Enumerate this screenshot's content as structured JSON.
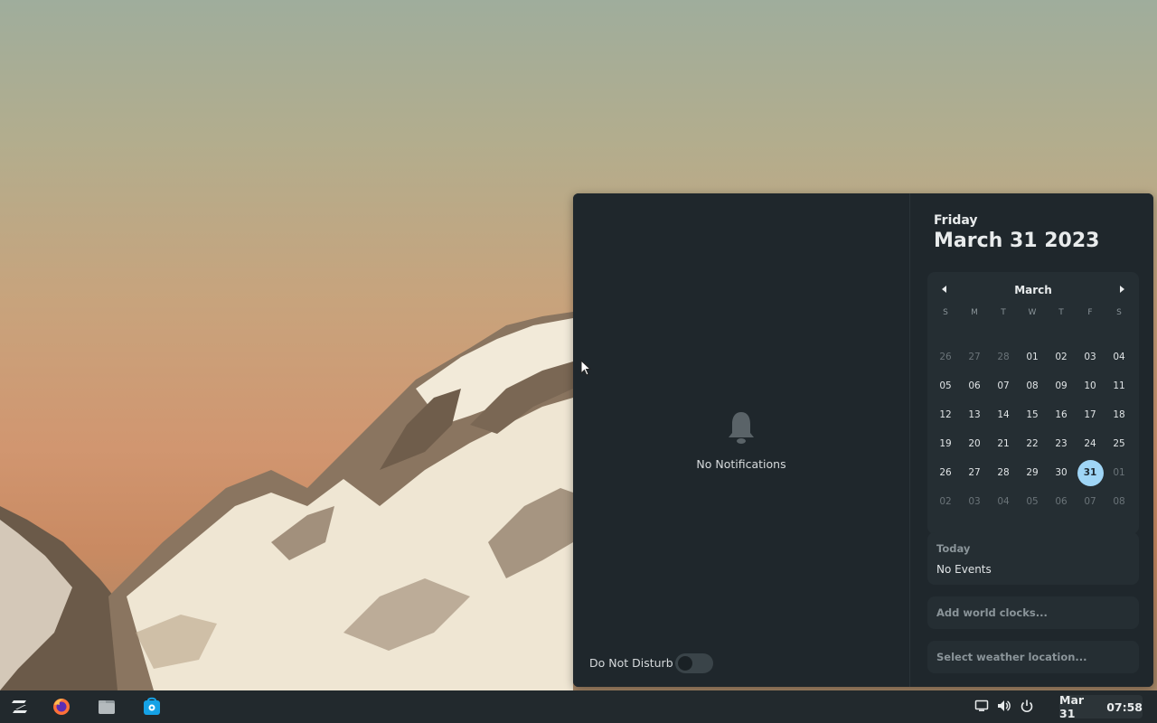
{
  "notifications": {
    "empty_label": "No Notifications",
    "dnd_label": "Do Not Disturb",
    "dnd_enabled": false
  },
  "date_header": {
    "day": "Friday",
    "date": "March 31 2023"
  },
  "calendar": {
    "month": "March",
    "weekdays": [
      "S",
      "M",
      "T",
      "W",
      "T",
      "F",
      "S"
    ],
    "weeks": [
      [
        "26",
        "27",
        "28",
        "01",
        "02",
        "03",
        "04"
      ],
      [
        "05",
        "06",
        "07",
        "08",
        "09",
        "10",
        "11"
      ],
      [
        "12",
        "13",
        "14",
        "15",
        "16",
        "17",
        "18"
      ],
      [
        "19",
        "20",
        "21",
        "22",
        "23",
        "24",
        "25"
      ],
      [
        "26",
        "27",
        "28",
        "29",
        "30",
        "31",
        "01"
      ],
      [
        "02",
        "03",
        "04",
        "05",
        "06",
        "07",
        "08"
      ]
    ],
    "selected_day": "31",
    "accent_color": "#9fd5f6"
  },
  "events": {
    "heading": "Today",
    "status": "No Events"
  },
  "world_clocks": {
    "placeholder": "Add world clocks..."
  },
  "weather": {
    "placeholder": "Select weather location..."
  },
  "taskbar": {
    "apps": [
      "zorin-menu-icon",
      "firefox-icon",
      "files-icon",
      "software-store-icon"
    ],
    "tray": [
      "display-icon",
      "volume-icon",
      "power-icon"
    ],
    "clock_date": "Mar 31",
    "clock_time": "07:58"
  }
}
